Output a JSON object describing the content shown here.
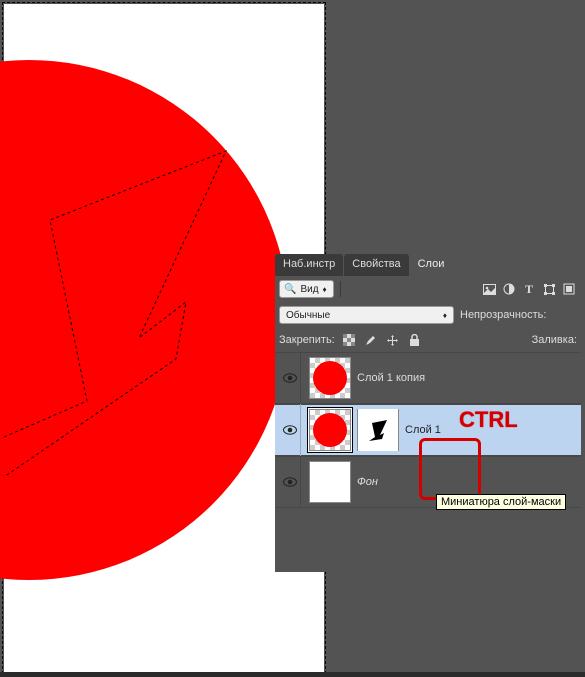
{
  "tabs": {
    "t1": "Наб.инстр",
    "t2": "Свойства",
    "t3": "Слои"
  },
  "filter": {
    "view": "Вид"
  },
  "blend": {
    "mode": "Обычные",
    "opacityLabel": "Непрозрачность:"
  },
  "lock": {
    "label": "Закрепить:",
    "fillLabel": "Заливка:"
  },
  "layers": {
    "l1": "Слой 1 копия",
    "l2": "Слой 1",
    "l3": "Фон"
  },
  "ctrl": "CTRL",
  "tooltip": "Миниатюра слой-маски",
  "icons": {
    "image": "image",
    "adjust": "adjust",
    "text": "T",
    "crop": "crop",
    "shape": "shape",
    "checker": "transparency",
    "brush": "brush",
    "arrow": "move",
    "square": "fill",
    "lockicon": "lock",
    "updown": "updown",
    "mag": "search",
    "eye": "visibility"
  }
}
